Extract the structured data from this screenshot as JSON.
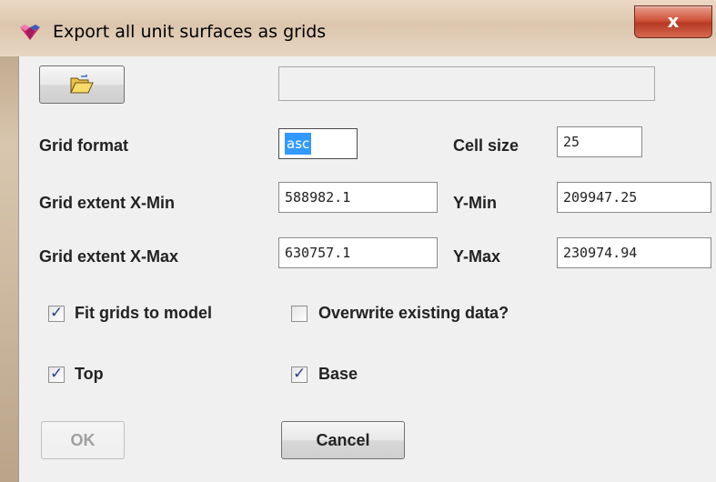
{
  "window": {
    "title": "Export all unit surfaces as grids",
    "close_label": "x"
  },
  "path": {
    "value": ""
  },
  "form": {
    "grid_format_label": "Grid format",
    "grid_format_value": "asc",
    "cell_size_label": "Cell size",
    "cell_size_value": "25",
    "xmin_label": "Grid extent X-Min",
    "xmin_value": "588982.1",
    "ymin_label": "Y-Min",
    "ymin_value": "209947.25",
    "xmax_label": "Grid extent X-Max",
    "xmax_value": "630757.1",
    "ymax_label": "Y-Max",
    "ymax_value": "230974.94"
  },
  "options": {
    "fit_grids": {
      "label": "Fit grids to model",
      "checked": true
    },
    "overwrite": {
      "label": "Overwrite existing data?",
      "checked": false
    },
    "top": {
      "label": "Top",
      "checked": true
    },
    "base": {
      "label": "Base",
      "checked": true
    }
  },
  "buttons": {
    "ok_label": "OK",
    "cancel_label": "Cancel"
  },
  "icons": {
    "open": "folder-open-icon",
    "app": "app-logo-icon"
  }
}
